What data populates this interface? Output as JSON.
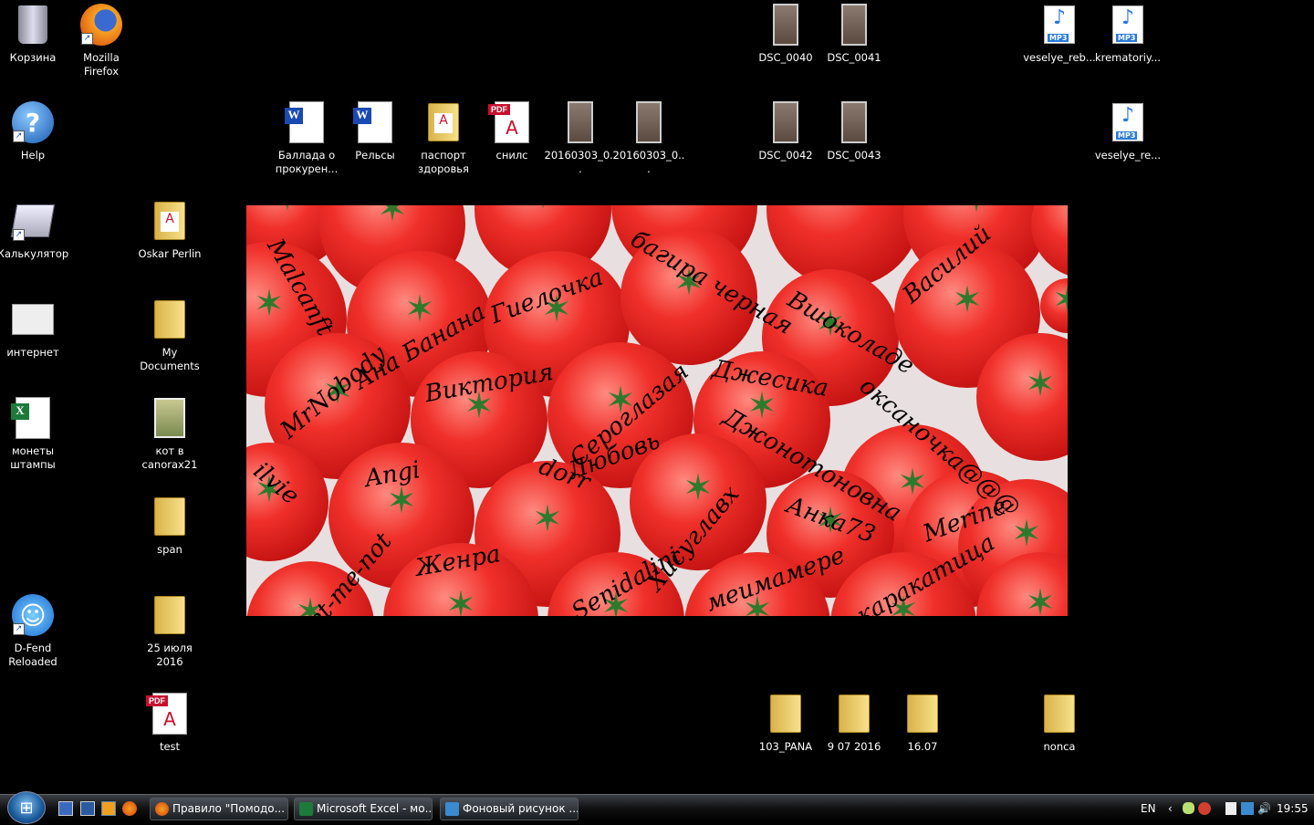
{
  "desktop_icons": [
    {
      "label": "Корзина",
      "icon": "recycle-bin-icon"
    },
    {
      "label": "Mozilla Firefox",
      "icon": "firefox-icon"
    },
    {
      "label": "Help",
      "icon": "help-icon"
    },
    {
      "label": "Калькулятор",
      "icon": "calculator-icon"
    },
    {
      "label": "интернет",
      "icon": "web-document-icon"
    },
    {
      "label": "монеты штампы",
      "icon": "excel-file-icon"
    },
    {
      "label": "D-Fend Reloaded",
      "icon": "dfend-icon"
    },
    {
      "label": "Oskar Perlin",
      "icon": "folder-pdf-icon"
    },
    {
      "label": "My Documents",
      "icon": "folder-icon"
    },
    {
      "label": "кот в canorax21",
      "icon": "image-file-icon"
    },
    {
      "label": "span",
      "icon": "folder-icon"
    },
    {
      "label": "25 июля 2016",
      "icon": "folder-icon"
    },
    {
      "label": "test",
      "icon": "pdf-file-icon"
    },
    {
      "label": "Баллада о прокурен...",
      "icon": "word-file-icon"
    },
    {
      "label": "Рельсы",
      "icon": "word-file-icon"
    },
    {
      "label": "паспорт здоровья",
      "icon": "folder-pdf-icon"
    },
    {
      "label": "снилс",
      "icon": "pdf-file-icon"
    },
    {
      "label": "20160303_0...",
      "icon": "photo-icon"
    },
    {
      "label": "20160303_0...",
      "icon": "photo-icon"
    },
    {
      "label": "DSC_0040",
      "icon": "photo-icon"
    },
    {
      "label": "DSC_0041",
      "icon": "photo-icon"
    },
    {
      "label": "DSC_0042",
      "icon": "photo-icon"
    },
    {
      "label": "DSC_0043",
      "icon": "photo-icon"
    },
    {
      "label": "veselye_reb...",
      "icon": "mp3-file-icon"
    },
    {
      "label": "krematoriy...",
      "icon": "mp3-file-icon"
    },
    {
      "label": "veselye_re...",
      "icon": "mp3-file-icon"
    },
    {
      "label": "103_PANA",
      "icon": "folder-icon"
    },
    {
      "label": "9 07 2016",
      "icon": "folder-icon"
    },
    {
      "label": "16.07",
      "icon": "folder-icon"
    },
    {
      "label": "nonca",
      "icon": "folder-icon"
    }
  ],
  "wallpaper_names": [
    "Malcanft",
    "Ана Банана",
    "Гиелочка",
    "багира черная",
    "Вшоколаде",
    "Василий",
    "MrNobody",
    "Виктория",
    "Сероглазая",
    "Джесика",
    "оксаночка@@@",
    "Джонотоновна",
    "Любовь",
    "ilvie",
    "Angi",
    "dorr",
    "Хисуглавх",
    "Анка73",
    "Merine",
    "Forget-me-not",
    "Женра",
    "Senidalini",
    "меимамере",
    "каракатица"
  ],
  "taskbar": {
    "start_label": "Start",
    "tasks": [
      {
        "label": "Правило \"Помодо...",
        "icon": "firefox-icon"
      },
      {
        "label": "Microsoft Excel - мо...",
        "icon": "excel-icon"
      },
      {
        "label": "Фоновый рисунок ...",
        "icon": "paint-icon"
      }
    ],
    "language": "EN",
    "clock": "19:55"
  },
  "colors": {
    "taskbar": "#1a1e22",
    "accent": "#1a5a9a"
  }
}
